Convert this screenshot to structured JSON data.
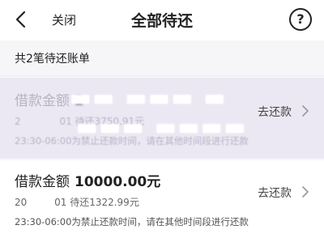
{
  "header": {
    "close_label": "关闭",
    "title": "全部待还",
    "help_symbol": "?"
  },
  "summary": {
    "text": "共2笔待还账单"
  },
  "bills": [
    {
      "amount_label": "借款金额",
      "amount_value": "2",
      "date_fragment": "2",
      "date_suffix": "01 待还3750.91元",
      "note": "23:30-06:00为禁止还款时间，请在其他时间段进行还款",
      "repay_label": "去还款"
    },
    {
      "amount_label": "借款金额",
      "amount_value": "10000.00元",
      "date_fragment": "20",
      "date_suffix": "01 待还1322.99元",
      "note": "23:30-06:00为禁止还款时间，请在其他时间段进行还款",
      "repay_label": "去还款"
    }
  ],
  "colors": {
    "background": "#f6f6f8",
    "card": "#ffffff",
    "faded_card": "#ebe8f3",
    "text_primary": "#222222",
    "text_secondary": "#666666"
  },
  "icons": {
    "back": "back-arrow-icon",
    "help": "help-icon",
    "chevron": "chevron-right-icon"
  }
}
